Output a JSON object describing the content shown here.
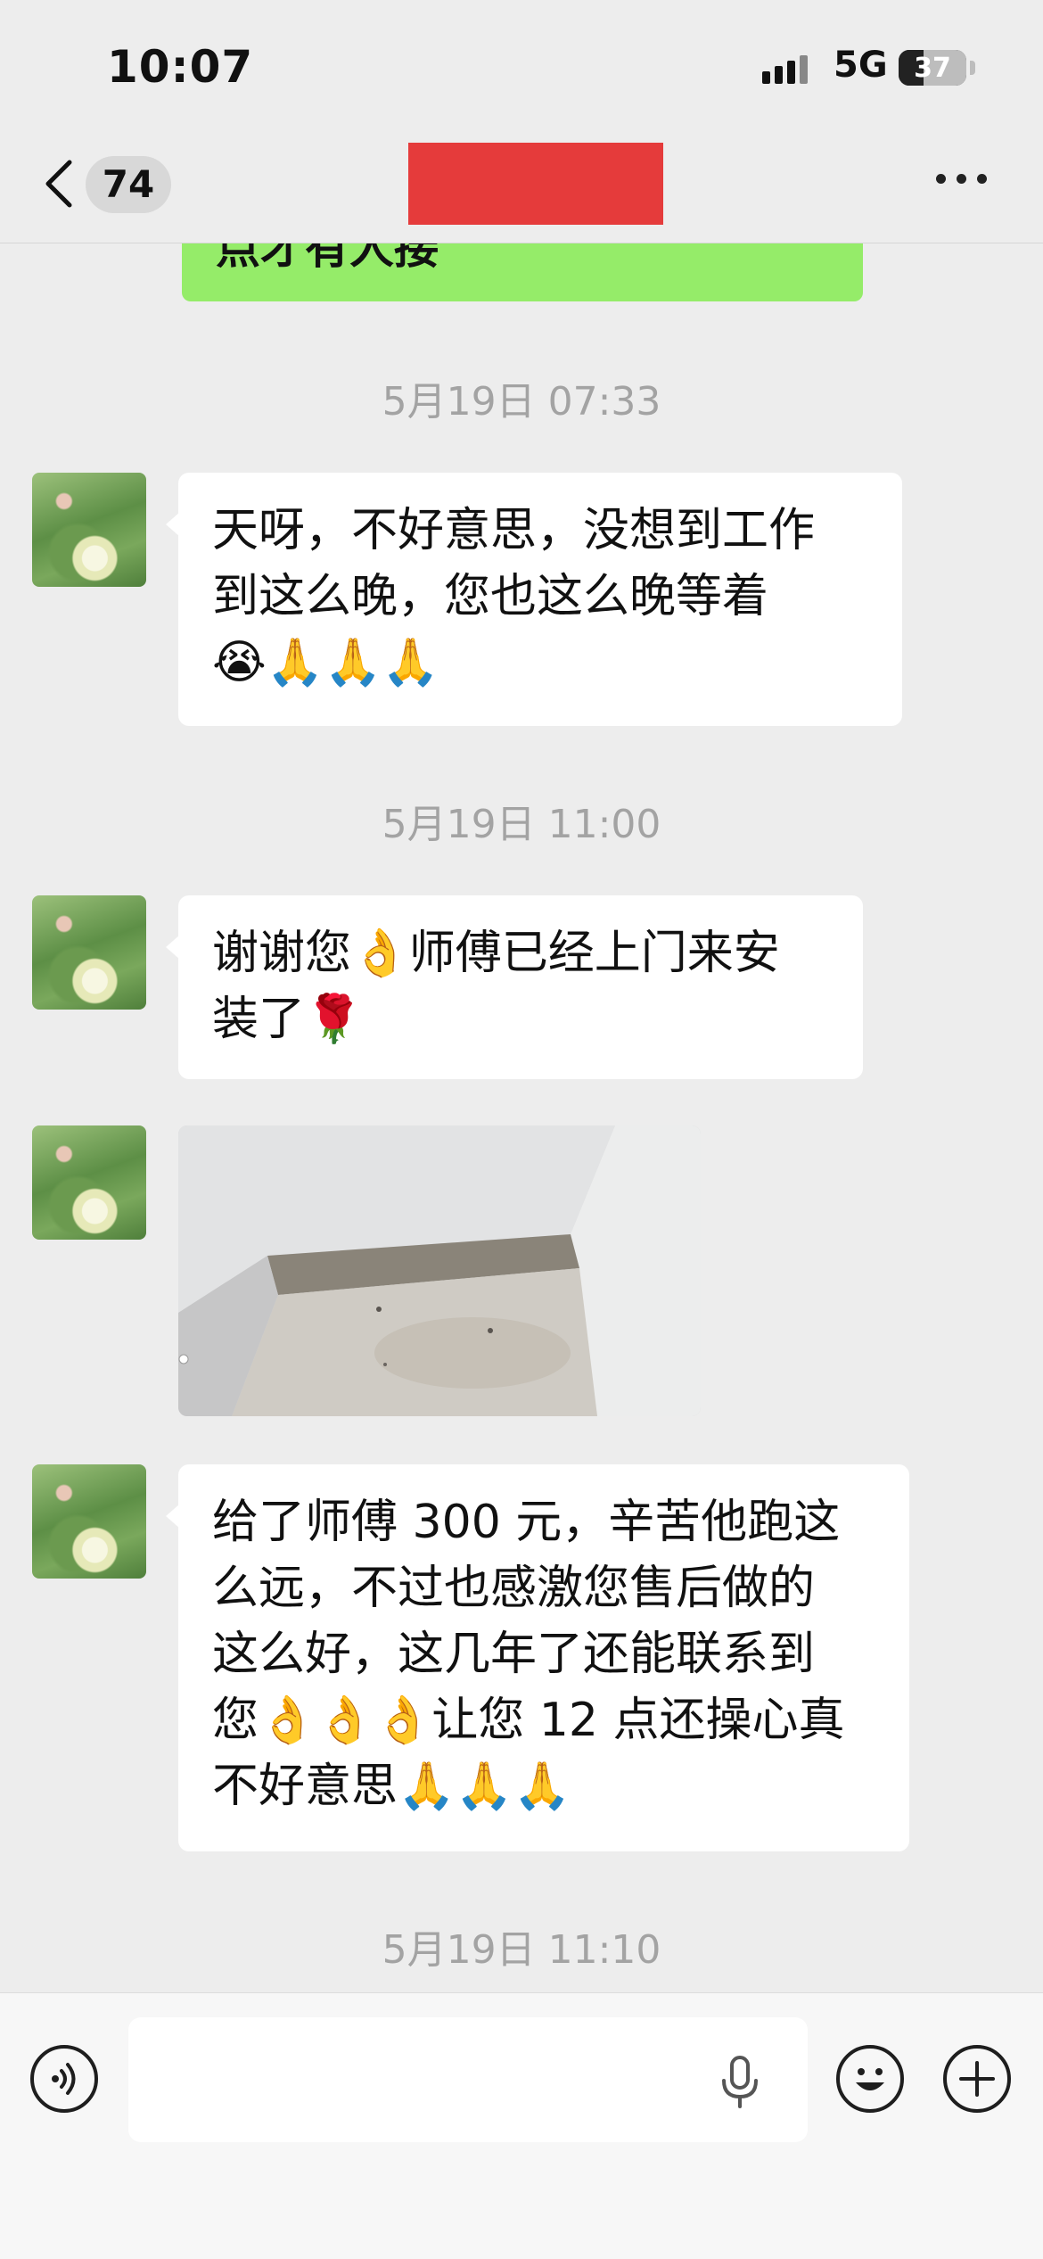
{
  "status_bar": {
    "time": "10:07",
    "network": "5G",
    "battery_level": "37",
    "icons": [
      "signal-icon",
      "battery-icon"
    ]
  },
  "nav": {
    "unread_count": "74",
    "title_redacted": true,
    "icons": [
      "back-chevron-icon",
      "more-icon"
    ]
  },
  "messages": {
    "prev_bubble_partial": "点才有人接",
    "ts1": "5月19日 07:33",
    "msg1": "天呀，不好意思，没想到工作\n到这么晚，您也这么晚等着\n😭🙏🙏🙏",
    "ts2": "5月19日 11:00",
    "msg2": "谢谢您👌师傅已经上门来安\n装了🌹",
    "photo": {
      "kind": "image",
      "alt_icon": "ceiling-vent-photo"
    },
    "msg3": "给了师傅 300 元，辛苦他跑这\n么远，不过也感激您售后做的\n这么好，这几年了还能联系到\n您👌👌👌让您 12 点还操心真\n不好意思🙏🙏🙏",
    "ts3": "5月19日 11:10"
  },
  "input_bar": {
    "value": "",
    "icons": [
      "voice-icon",
      "mic-icon",
      "emoji-icon",
      "plus-icon"
    ]
  },
  "colors": {
    "bg": "#ededed",
    "self_bubble": "#95ec69",
    "other_bubble": "#ffffff",
    "redact": "#e53b3b",
    "timestamp": "#a3a3a3"
  }
}
